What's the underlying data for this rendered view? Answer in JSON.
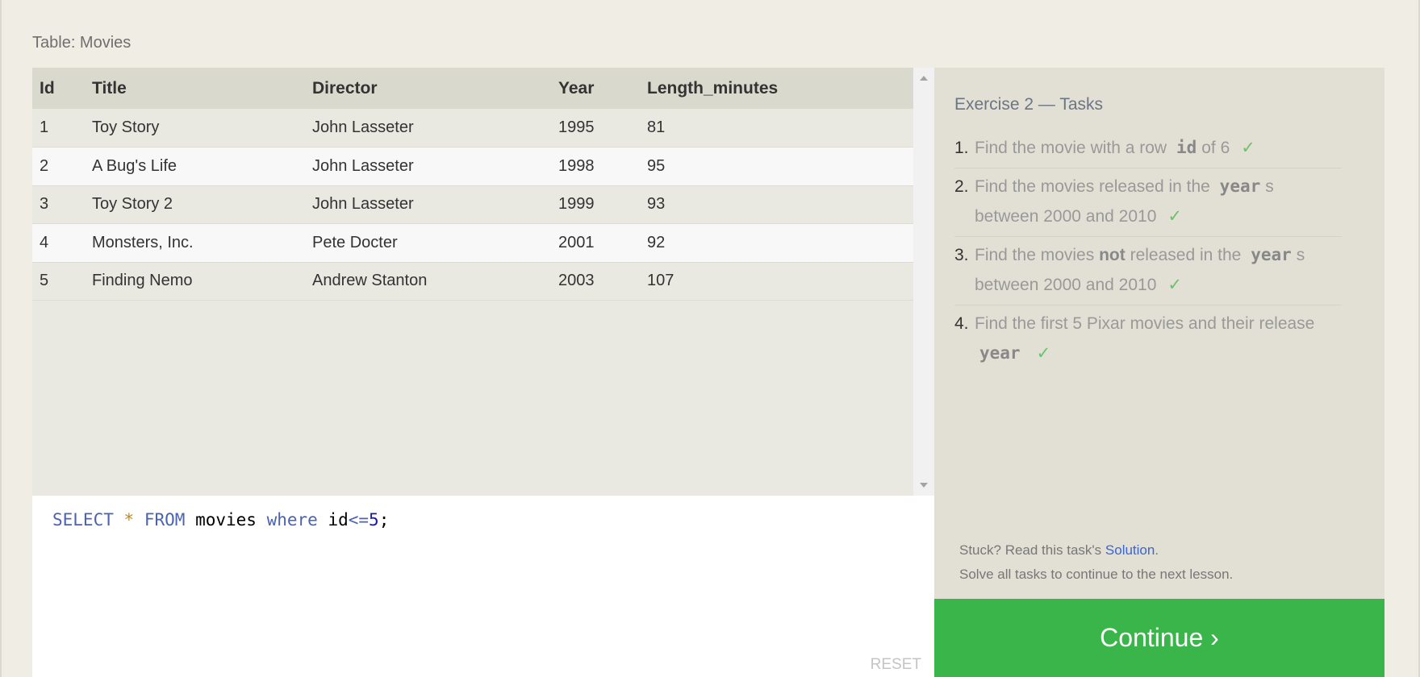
{
  "table_label": "Table: Movies",
  "columns": [
    "Id",
    "Title",
    "Director",
    "Year",
    "Length_minutes"
  ],
  "rows": [
    [
      "1",
      "Toy Story",
      "John Lasseter",
      "1995",
      "81"
    ],
    [
      "2",
      "A Bug's Life",
      "John Lasseter",
      "1998",
      "95"
    ],
    [
      "3",
      "Toy Story 2",
      "John Lasseter",
      "1999",
      "93"
    ],
    [
      "4",
      "Monsters, Inc.",
      "Pete Docter",
      "2001",
      "92"
    ],
    [
      "5",
      "Finding Nemo",
      "Andrew Stanton",
      "2003",
      "107"
    ]
  ],
  "editor": {
    "kw1": "SELECT",
    "star": "*",
    "kw2": "FROM",
    "table": "movies",
    "kw3": "where",
    "col": "id",
    "op": "<=",
    "num": "5",
    "end": ";",
    "reset": "RESET"
  },
  "tasks": {
    "title": "Exercise 2 — Tasks",
    "items": [
      {
        "n": "1.",
        "a": "Find the movie with a row",
        "code": "id",
        "b": "of 6",
        "check": "✓"
      },
      {
        "n": "2.",
        "a": "Find the movies released in the",
        "code": "year",
        "b": "s between 2000 and 2010",
        "check": "✓"
      },
      {
        "n": "3.",
        "a": "Find the movies",
        "bold": "not",
        "a2": "released in the",
        "code": "year",
        "b": "s between 2000 and 2010",
        "check": "✓"
      },
      {
        "n": "4.",
        "a": "Find the first 5 Pixar movies and their release",
        "code": "year",
        "check": "✓"
      }
    ],
    "stuck_prefix": "Stuck? Read this task's",
    "solution_link": "Solution",
    "stuck_suffix": ".",
    "solve_all": "Solve all tasks to continue to the next lesson."
  },
  "continue_label": "Continue ›",
  "colors": {
    "accent": "#3ab54a",
    "link": "#3b64d4"
  }
}
